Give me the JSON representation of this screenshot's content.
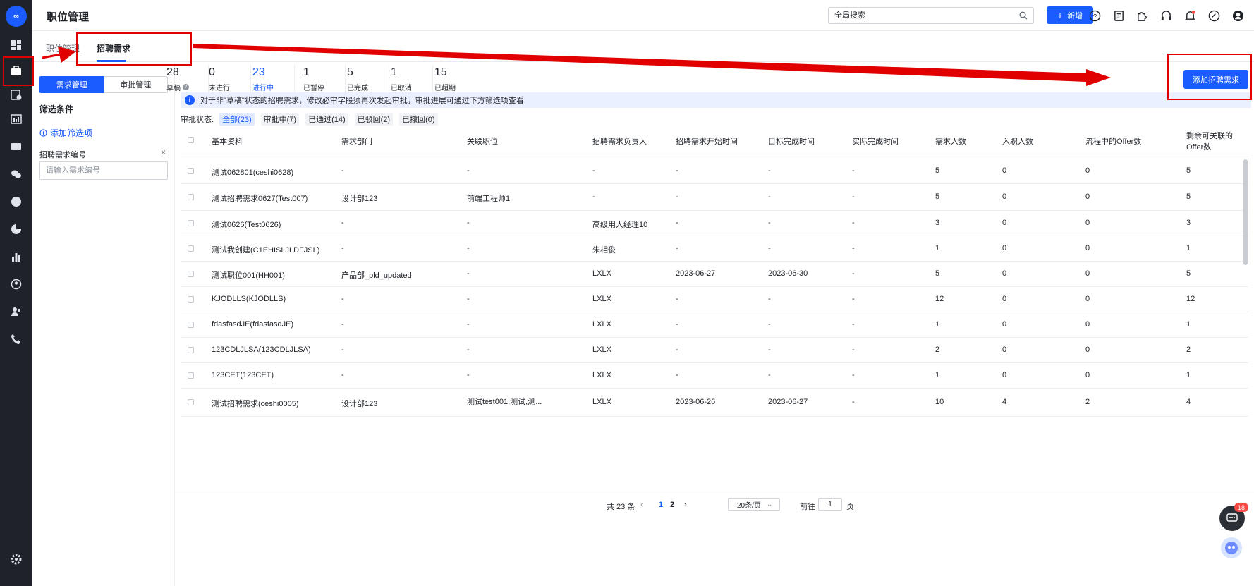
{
  "app": {
    "title": "职位管理",
    "logo_text": "∞"
  },
  "topbar": {
    "search_placeholder": "全局搜索",
    "new_label": "新增",
    "icons": [
      "help-icon",
      "document-icon",
      "puzzle-icon",
      "headset-icon",
      "bell-icon",
      "link-icon",
      "user-icon"
    ],
    "bell_has_dot": true
  },
  "tabs": [
    {
      "label": "职位管理",
      "active": false
    },
    {
      "label": "招聘需求",
      "active": true
    }
  ],
  "left_panel": {
    "seg_left": "需求管理",
    "seg_right": "审批管理",
    "filter_title": "筛选条件",
    "add_filter": "添加筛选项",
    "field_label": "招聘需求编号",
    "field_placeholder": "请输入需求编号"
  },
  "stats": [
    {
      "num": "28",
      "label": "草稿",
      "active": false,
      "has_help": true
    },
    {
      "num": "0",
      "label": "未进行",
      "active": false,
      "has_help": false
    },
    {
      "num": "23",
      "label": "进行中",
      "active": true,
      "has_help": false
    },
    {
      "num": "1",
      "label": "已暂停",
      "active": false,
      "has_help": false
    },
    {
      "num": "5",
      "label": "已完成",
      "active": false,
      "has_help": false
    },
    {
      "num": "1",
      "label": "已取消",
      "active": false,
      "has_help": false
    },
    {
      "num": "15",
      "label": "已超期",
      "active": false,
      "has_help": false
    }
  ],
  "add_request_button": "添加招聘需求",
  "notice": "对于非\"草稿\"状态的招聘需求，修改必审字段须再次发起审批，审批进展可通过下方筛选项查看",
  "approval": {
    "label": "审批状态:",
    "chips": [
      {
        "label": "全部(23)",
        "active": true
      },
      {
        "label": "审批中(7)",
        "active": false
      },
      {
        "label": "已通过(14)",
        "active": false
      },
      {
        "label": "已驳回(2)",
        "active": false
      },
      {
        "label": "已撤回(0)",
        "active": false
      }
    ]
  },
  "table": {
    "headers": [
      "基本资料",
      "需求部门",
      "关联职位",
      "招聘需求负责人",
      "招聘需求开始时间",
      "目标完成时间",
      "实际完成时间",
      "需求人数",
      "入职人数",
      "流程中的Offer数",
      "剩余可关联的",
      "Offer数"
    ],
    "rows": [
      [
        "测试062801(ceshi0628)",
        "-",
        "-",
        "-",
        "-",
        "-",
        "-",
        "5",
        "0",
        "0",
        "5"
      ],
      [
        "测试招聘需求0627(Test007)",
        "设计部123",
        "前端工程师1",
        "-",
        "-",
        "-",
        "-",
        "5",
        "0",
        "0",
        "5"
      ],
      [
        "测试0626(Test0626)",
        "-",
        "-",
        "高级用人经理10",
        "-",
        "-",
        "-",
        "3",
        "0",
        "0",
        "3"
      ],
      [
        "测试我创建(C1EHISLJLDFJSL)",
        "-",
        "-",
        "朱相俊",
        "-",
        "-",
        "-",
        "1",
        "0",
        "0",
        "1"
      ],
      [
        "测试职位001(HH001)",
        "产品部_pld_updated",
        "-",
        "LXLX",
        "2023-06-27",
        "2023-06-30",
        "-",
        "5",
        "0",
        "0",
        "5"
      ],
      [
        "KJODLLS(KJODLLS)",
        "-",
        "-",
        "LXLX",
        "-",
        "-",
        "-",
        "12",
        "0",
        "0",
        "12"
      ],
      [
        "fdasfasdJE(fdasfasdJE)",
        "-",
        "-",
        "LXLX",
        "-",
        "-",
        "-",
        "1",
        "0",
        "0",
        "1"
      ],
      [
        "123CDLJLSA(123CDLJLSA)",
        "-",
        "-",
        "LXLX",
        "-",
        "-",
        "-",
        "2",
        "0",
        "0",
        "2"
      ],
      [
        "123CET(123CET)",
        "-",
        "-",
        "LXLX",
        "-",
        "-",
        "-",
        "1",
        "0",
        "0",
        "1"
      ],
      [
        "测试招聘需求(ceshi0005)",
        "设计部123",
        "测试test001,测试,测...",
        "LXLX",
        "2023-06-26",
        "2023-06-27",
        "-",
        "10",
        "4",
        "2",
        "4"
      ]
    ]
  },
  "pagination": {
    "total": "共 23 条",
    "prev": "‹",
    "pages": [
      "1",
      "2"
    ],
    "current": "1",
    "next": "›",
    "page_size": "20条/页",
    "goto_label": "前往",
    "goto_value": "1",
    "page_unit": "页"
  },
  "chat_badge": "18",
  "accent": "#1a5cff",
  "annotation_color": "#e00000"
}
